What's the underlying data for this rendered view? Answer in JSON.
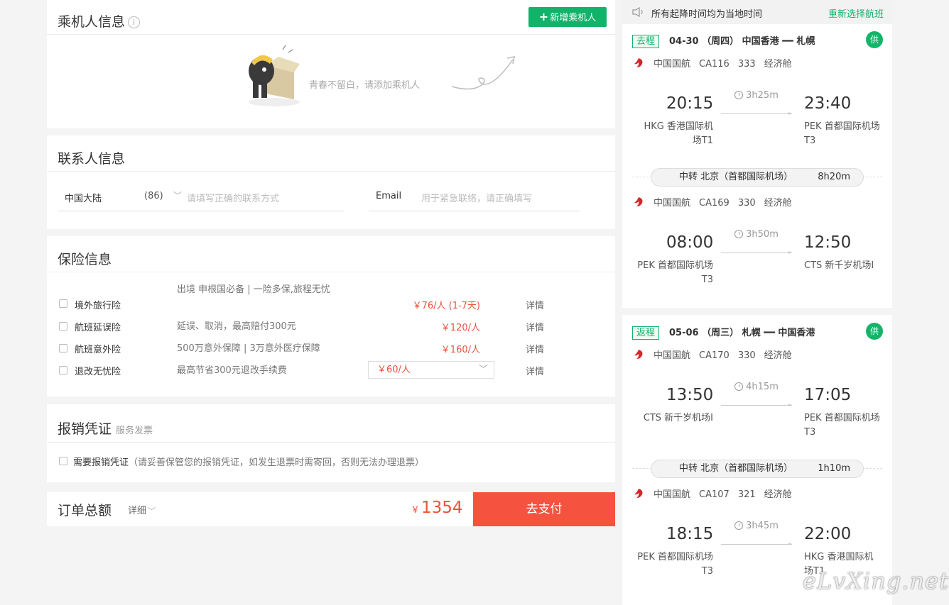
{
  "passenger": {
    "title": "乘机人信息",
    "add_button": "新增乘机人",
    "empty_text": "青春不留白，请添加乘机人"
  },
  "contact": {
    "title": "联系人信息",
    "region": "中国大陆",
    "region_code": "(86)",
    "phone_placeholder": "请填写正确的联系方式",
    "email_label": "Email",
    "email_placeholder": "用于紧急联络，请正确填写"
  },
  "insurance": {
    "title": "保险信息",
    "detail_label": "详情",
    "items": [
      {
        "name": "境外旅行险",
        "desc": "出境 申根国必备 | 一险多保,旅程无忧",
        "price": "￥76/人 (1-7天)"
      },
      {
        "name": "航班延误险",
        "desc": "延误、取消，最高赔付300元",
        "price": "￥120/人"
      },
      {
        "name": "航班意外险",
        "desc": "500万意外保障 | 3万意外医疗保障",
        "price": "￥160/人"
      },
      {
        "name": "退改无忧险",
        "desc": "最高节省300元退改手续费",
        "price": "￥60/人"
      }
    ]
  },
  "invoice": {
    "title": "报销凭证",
    "subtitle": "服务发票",
    "checkbox_label": "需要报销凭证",
    "note": "（请妥善保管您的报销凭证，如发生退票时需寄回，否则无法办理退票）"
  },
  "total": {
    "label": "订单总额",
    "detail": "详细",
    "currency": "￥",
    "amount": "1354",
    "pay_button": "去支付"
  },
  "right_panel": {
    "notice": "所有起降时间均为当地时间",
    "rechoose": "重新选择航班",
    "supply_badge": "供",
    "outbound": {
      "tag": "去程",
      "date": "04-30",
      "weekday": "（周四）",
      "route": "中国香港 ━━ 札幌",
      "segments": [
        {
          "airline": "中国国航",
          "flight": "CA116",
          "plane": "333",
          "cabin": "经济舱",
          "dep_time": "20:15",
          "arr_time": "23:40",
          "duration": "3h25m",
          "dep_airport": "HKG 香港国际机场T1",
          "arr_airport": "PEK 首都国际机场T3"
        },
        {
          "airline": "中国国航",
          "flight": "CA169",
          "plane": "330",
          "cabin": "经济舱",
          "dep_time": "08:00",
          "arr_time": "12:50",
          "duration": "3h50m",
          "dep_airport": "PEK 首都国际机场T3",
          "arr_airport": "CTS 新千岁机场I"
        }
      ],
      "transfer": {
        "city": "中转 北京（首都国际机场）",
        "duration": "8h20m"
      }
    },
    "return": {
      "tag": "返程",
      "date": "05-06",
      "weekday": "（周三）",
      "route": "札幌 ━━ 中国香港",
      "segments": [
        {
          "airline": "中国国航",
          "flight": "CA170",
          "plane": "330",
          "cabin": "经济舱",
          "dep_time": "13:50",
          "arr_time": "17:05",
          "duration": "4h15m",
          "dep_airport": "CTS 新千岁机场I",
          "arr_airport": "PEK 首都国际机场T3"
        },
        {
          "airline": "中国国航",
          "flight": "CA107",
          "plane": "321",
          "cabin": "经济舱",
          "dep_time": "18:15",
          "arr_time": "22:00",
          "duration": "3h45m",
          "dep_airport": "PEK 首都国际机场T3",
          "arr_airport": "HKG 香港国际机场T1"
        }
      ],
      "transfer": {
        "city": "中转 北京（首都国际机场）",
        "duration": "1h10m"
      }
    }
  },
  "watermark": "eLvXing.net"
}
